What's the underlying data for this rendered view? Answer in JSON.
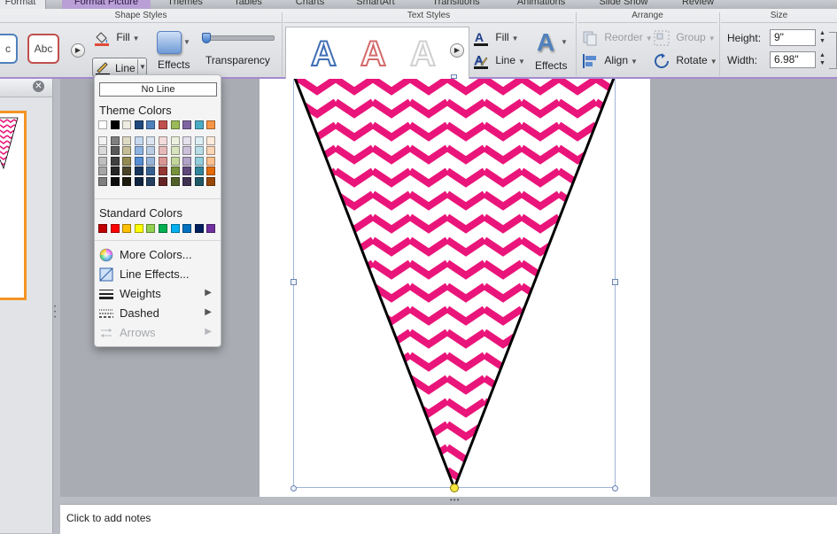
{
  "tabs": [
    {
      "label": "Format",
      "state": "active"
    },
    {
      "label": "Format Picture",
      "state": "picture"
    },
    {
      "label": "Themes",
      "state": "normal"
    },
    {
      "label": "Tables",
      "state": "normal"
    },
    {
      "label": "Charts",
      "state": "normal"
    },
    {
      "label": "SmartArt",
      "state": "normal"
    },
    {
      "label": "Transitions",
      "state": "normal"
    },
    {
      "label": "Animations",
      "state": "normal"
    },
    {
      "label": "Slide Show",
      "state": "normal"
    },
    {
      "label": "Review",
      "state": "normal"
    }
  ],
  "ribbon": {
    "shape_styles": {
      "title": "Shape Styles",
      "style_sample_label": "Abc",
      "style_sample_partial": "c",
      "fill_label": "Fill",
      "line_label": "Line",
      "effects_label": "Effects",
      "transparency_label": "Transparency",
      "transparency_level_percent": 5
    },
    "text_styles": {
      "title": "Text Styles",
      "wordart_glyph": "A",
      "fill_label": "Fill",
      "line_label": "Line",
      "effects_label": "Effects"
    },
    "arrange": {
      "title": "Arrange",
      "reorder_label": "Reorder",
      "group_label": "Group",
      "align_label": "Align",
      "rotate_label": "Rotate"
    },
    "size": {
      "title": "Size",
      "height_label": "Height:",
      "height_value": "9\"",
      "width_label": "Width:",
      "width_value": "6.98\""
    }
  },
  "line_menu": {
    "no_line_label": "No Line",
    "theme_colors_label": "Theme Colors",
    "theme_colors": [
      "#ffffff",
      "#000000",
      "#eeece1",
      "#1f497d",
      "#4f81bd",
      "#c0504d",
      "#9bbb59",
      "#8064a2",
      "#4bacc6",
      "#f79646"
    ],
    "theme_shades": [
      [
        "#f2f2f2",
        "#d9d9d9",
        "#bfbfbf",
        "#a6a6a6",
        "#7f7f7f"
      ],
      [
        "#7f7f7f",
        "#595959",
        "#404040",
        "#262626",
        "#0d0d0d"
      ],
      [
        "#ddd9c3",
        "#c4bd97",
        "#948a54",
        "#4a452a",
        "#1e1c11"
      ],
      [
        "#c6d9f0",
        "#8db3e2",
        "#548dd4",
        "#17365d",
        "#0f243e"
      ],
      [
        "#dbe5f1",
        "#b8cce4",
        "#95b3d7",
        "#366092",
        "#244061"
      ],
      [
        "#f2dcdb",
        "#e5b9b7",
        "#d99694",
        "#953734",
        "#632423"
      ],
      [
        "#ebf1dd",
        "#d7e3bc",
        "#c3d69b",
        "#76923c",
        "#4f6128"
      ],
      [
        "#e5e0ec",
        "#ccc1d9",
        "#b2a2c7",
        "#5f497a",
        "#3f3151"
      ],
      [
        "#dbeef3",
        "#b7dde8",
        "#92cddc",
        "#31859b",
        "#205867"
      ],
      [
        "#fdeada",
        "#fbd5b5",
        "#fac08f",
        "#e36c09",
        "#974806"
      ]
    ],
    "standard_colors_label": "Standard Colors",
    "standard_colors": [
      "#c00000",
      "#ff0000",
      "#ffc000",
      "#ffff00",
      "#92d050",
      "#00b050",
      "#00b0f0",
      "#0070c0",
      "#002060",
      "#7030a0"
    ],
    "items": [
      {
        "label": "More Colors...",
        "icon": "color-wheel-icon",
        "submenu": false,
        "disabled": false
      },
      {
        "label": "Line Effects...",
        "icon": "line-effects-icon",
        "submenu": false,
        "disabled": false
      },
      {
        "label": "Weights",
        "icon": "weights-icon",
        "submenu": true,
        "disabled": false
      },
      {
        "label": "Dashed",
        "icon": "dashed-icon",
        "submenu": true,
        "disabled": false
      },
      {
        "label": "Arrows",
        "icon": "arrows-icon",
        "submenu": true,
        "disabled": true
      }
    ]
  },
  "slide": {
    "chevron_color": "#ea157a",
    "outline_color": "#000000"
  },
  "notes": {
    "placeholder": "Click to add notes"
  },
  "colors": {
    "accent_purple": "#a48bd0",
    "thumbnail_border": "#f39424"
  }
}
